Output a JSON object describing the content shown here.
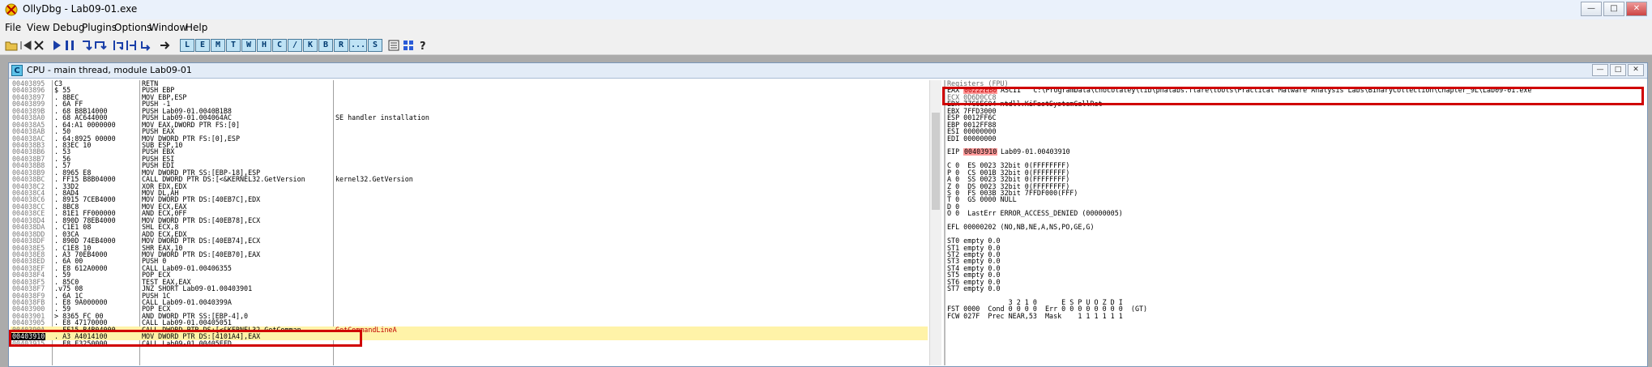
{
  "window": {
    "title": "OllyDbg - Lab09-01.exe"
  },
  "menu": [
    "File",
    "View",
    "Debug",
    "Plugins",
    "Options",
    "Window",
    "Help"
  ],
  "toolbar": {
    "letters": [
      "L",
      "E",
      "M",
      "T",
      "W",
      "H",
      "C",
      "/",
      "K",
      "B",
      "R",
      "...",
      "S"
    ]
  },
  "cpu": {
    "title": "CPU - main thread, module Lab09-01",
    "icon_letter": "C"
  },
  "disasm": [
    {
      "addr": "00403895",
      "hex": "C3",
      "asm": "RETN",
      "comment": ""
    },
    {
      "addr": "00403896",
      "hex": "$ 55",
      "asm": "PUSH EBP",
      "comment": ""
    },
    {
      "addr": "00403897",
      "hex": ". 8BEC",
      "asm": "MOV EBP,ESP",
      "comment": ""
    },
    {
      "addr": "00403899",
      "hex": ". 6A FF",
      "asm": "PUSH -1",
      "comment": ""
    },
    {
      "addr": "0040389B",
      "hex": ". 68 B8B14000",
      "asm": "PUSH Lab09-01.0040B1B8",
      "comment": ""
    },
    {
      "addr": "004038A0",
      "hex": ". 68 AC644000",
      "asm": "PUSH Lab09-01.004064AC",
      "comment": "SE handler installation"
    },
    {
      "addr": "004038A5",
      "hex": ". 64:A1 0000000",
      "asm": "MOV EAX,DWORD PTR FS:[0]",
      "comment": ""
    },
    {
      "addr": "004038AB",
      "hex": ". 50",
      "asm": "PUSH EAX",
      "comment": ""
    },
    {
      "addr": "004038AC",
      "hex": ". 64:8925 00000",
      "asm": "MOV DWORD PTR FS:[0],ESP",
      "comment": ""
    },
    {
      "addr": "004038B3",
      "hex": ". 83EC 10",
      "asm": "SUB ESP,10",
      "comment": ""
    },
    {
      "addr": "004038B6",
      "hex": ". 53",
      "asm": "PUSH EBX",
      "comment": ""
    },
    {
      "addr": "004038B7",
      "hex": ". 56",
      "asm": "PUSH ESI",
      "comment": ""
    },
    {
      "addr": "004038B8",
      "hex": ". 57",
      "asm": "PUSH EDI",
      "comment": ""
    },
    {
      "addr": "004038B9",
      "hex": ". 8965 E8",
      "asm": "MOV DWORD PTR SS:[EBP-18],ESP",
      "comment": ""
    },
    {
      "addr": "004038BC",
      "hex": ". FF15 B8B04000",
      "asm": "CALL DWORD PTR DS:[<&KERNEL32.GetVersion",
      "comment": "kernel32.GetVersion"
    },
    {
      "addr": "004038C2",
      "hex": ". 33D2",
      "asm": "XOR EDX,EDX",
      "comment": ""
    },
    {
      "addr": "004038C4",
      "hex": ". 8AD4",
      "asm": "MOV DL,AH",
      "comment": ""
    },
    {
      "addr": "004038C6",
      "hex": ". 8915 7CEB4000",
      "asm": "MOV DWORD PTR DS:[40EB7C],EDX",
      "comment": ""
    },
    {
      "addr": "004038CC",
      "hex": ". 8BC8",
      "asm": "MOV ECX,EAX",
      "comment": ""
    },
    {
      "addr": "004038CE",
      "hex": ". 81E1 FF000000",
      "asm": "AND ECX,0FF",
      "comment": ""
    },
    {
      "addr": "004038D4",
      "hex": ". 890D 78EB4000",
      "asm": "MOV DWORD PTR DS:[40EB78],ECX",
      "comment": ""
    },
    {
      "addr": "004038DA",
      "hex": ". C1E1 08",
      "asm": "SHL ECX,8",
      "comment": ""
    },
    {
      "addr": "004038DD",
      "hex": ". 03CA",
      "asm": "ADD ECX,EDX",
      "comment": ""
    },
    {
      "addr": "004038DF",
      "hex": ". 890D 74EB4000",
      "asm": "MOV DWORD PTR DS:[40EB74],ECX",
      "comment": ""
    },
    {
      "addr": "004038E5",
      "hex": ". C1E8 10",
      "asm": "SHR EAX,10",
      "comment": ""
    },
    {
      "addr": "004038E8",
      "hex": ". A3 70EB4000",
      "asm": "MOV DWORD PTR DS:[40EB70],EAX",
      "comment": ""
    },
    {
      "addr": "004038ED",
      "hex": ". 6A 00",
      "asm": "PUSH 0",
      "comment": ""
    },
    {
      "addr": "004038EF",
      "hex": ". E8 612A0000",
      "asm": "CALL Lab09-01.00406355",
      "comment": ""
    },
    {
      "addr": "004038F4",
      "hex": ". 59",
      "asm": "POP ECX",
      "comment": ""
    },
    {
      "addr": "004038F5",
      "hex": ". 85C0",
      "asm": "TEST EAX,EAX",
      "comment": ""
    },
    {
      "addr": "004038F7",
      "hex": ".v75 08",
      "asm": "JNZ SHORT Lab09-01.00403901",
      "comment": ""
    },
    {
      "addr": "004038F9",
      "hex": ". 6A 1C",
      "asm": "PUSH 1C",
      "comment": ""
    },
    {
      "addr": "004038FB",
      "hex": ". E8 9A000000",
      "asm": "CALL Lab09-01.0040399A",
      "comment": ""
    },
    {
      "addr": "00403900",
      "hex": ". 59",
      "asm": "POP ECX",
      "comment": ""
    },
    {
      "addr": "00403901",
      "hex": "> 8365 FC 00",
      "asm": "AND DWORD PTR SS:[EBP-4],0",
      "comment": ""
    },
    {
      "addr": "00403905",
      "hex": ". E8 47170000",
      "asm": "CALL Lab09-01.00405051",
      "comment": ""
    },
    {
      "addr": "0040390A",
      "hex": ". FF15 B4B04000",
      "asm": "CALL DWORD PTR DS:[<&KERNEL32.GetComman",
      "comment": "GetCommandLineA"
    },
    {
      "addr": "00403910",
      "hex": ". A3 A4014100",
      "asm": "MOV DWORD PTR DS:[4101A4],EAX",
      "comment": ""
    },
    {
      "addr": "00403915",
      "hex": ". E8 E3250000",
      "asm": "CALL Lab09-01.00405EFD",
      "comment": ""
    }
  ],
  "registers": {
    "header": "Registers (FPU)",
    "eax": {
      "name": "EAX",
      "value": "00222EB0",
      "text": "ASCII \"\"C:\\ProgramData\\chocolatey\\lib\\pnalabs.flare\\tools\\Practical Malware Analysis Labs\\BinaryCollection\\Chapter_9L\\Lab09-01.exe\"\""
    },
    "lines": [
      "ECX 0D6D0CC8",
      "EDX 77C6EC04 ntdll.KiFastSystemCallRet",
      "EBX 7FFD3000",
      "ESP 0012FF6C",
      "EBP 0012FF88",
      "ESI 00000000",
      "EDI 00000000"
    ],
    "eip": {
      "name": "EIP",
      "value": "00403910",
      "text": "Lab09-01.00403910"
    },
    "flags": [
      "C 0  ES 0023 32bit 0(FFFFFFFF)",
      "P 0  CS 001B 32bit 0(FFFFFFFF)",
      "A 0  SS 0023 32bit 0(FFFFFFFF)",
      "Z 0  DS 0023 32bit 0(FFFFFFFF)",
      "S 0  FS 003B 32bit 7FFDF000(FFF)",
      "T 0  GS 0000 NULL",
      "D 0",
      "O 0  LastErr ERROR_ACCESS_DENIED (00000005)"
    ],
    "efl": "EFL 00000202 (NO,NB,NE,A,NS,PO,GE,G)",
    "fpu": [
      "ST0 empty 0.0",
      "ST1 empty 0.0",
      "ST2 empty 0.0",
      "ST3 empty 0.0",
      "ST4 empty 0.0",
      "ST5 empty 0.0",
      "ST6 empty 0.0",
      "ST7 empty 0.0"
    ],
    "fst_header": "               3 2 1 0      E S P U O Z D I",
    "fst": "FST 0000  Cond 0 0 0 0  Err 0 0 0 0 0 0 0 0  (GT)",
    "fcw": "FCW 027F  Prec NEAR,53  Mask    1 1 1 1 1 1"
  }
}
